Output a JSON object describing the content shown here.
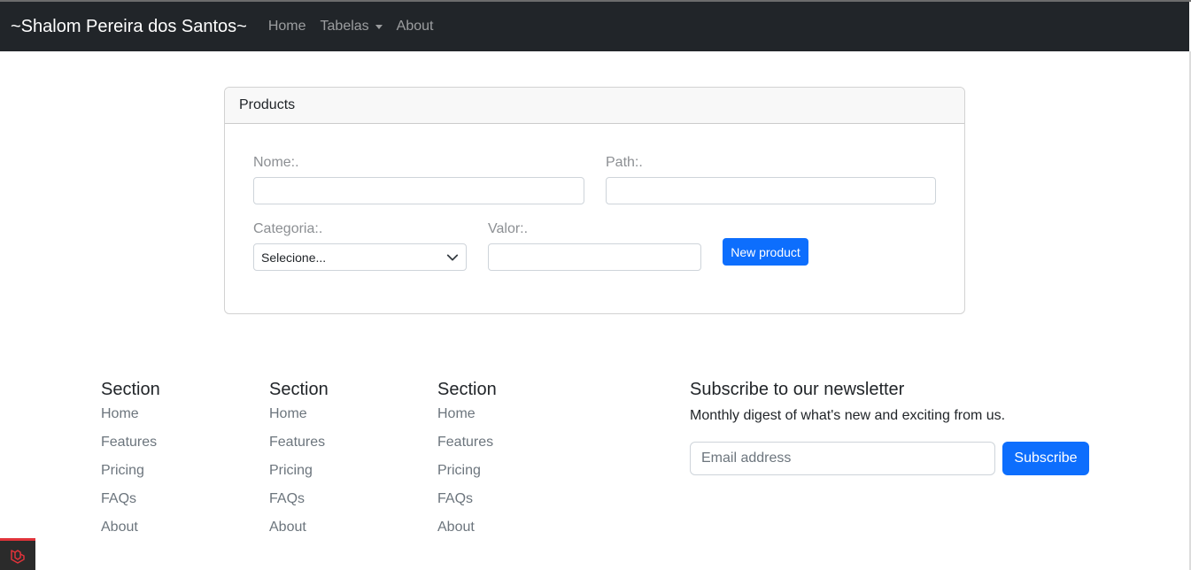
{
  "navbar": {
    "brand": "~Shalom Pereira dos Santos~",
    "links": [
      {
        "label": "Home"
      },
      {
        "label": "Tabelas",
        "dropdown": true
      },
      {
        "label": "About"
      }
    ]
  },
  "card": {
    "title": "Products",
    "nome_label": "Nome:.",
    "path_label": "Path:.",
    "categoria_label": "Categoria:.",
    "categoria_selected": "Selecione...",
    "valor_label": "Valor:.",
    "submit_label": "New product"
  },
  "footer": {
    "sections": [
      {
        "heading": "Section",
        "links": [
          "Home",
          "Features",
          "Pricing",
          "FAQs",
          "About"
        ]
      },
      {
        "heading": "Section",
        "links": [
          "Home",
          "Features",
          "Pricing",
          "FAQs",
          "About"
        ]
      },
      {
        "heading": "Section",
        "links": [
          "Home",
          "Features",
          "Pricing",
          "FAQs",
          "About"
        ]
      }
    ],
    "newsletter": {
      "title": "Subscribe to our newsletter",
      "description": "Monthly digest of what's new and exciting from us.",
      "email_placeholder": "Email address",
      "button_label": "Subscribe"
    }
  },
  "colors": {
    "navbar_bg": "#212529",
    "primary": "#0d6efd",
    "laravel_red": "#e0333a"
  },
  "icons": {
    "dropdown": "caret-down-icon",
    "select": "chevron-down-icon",
    "badge": "laravel-logo-icon"
  }
}
